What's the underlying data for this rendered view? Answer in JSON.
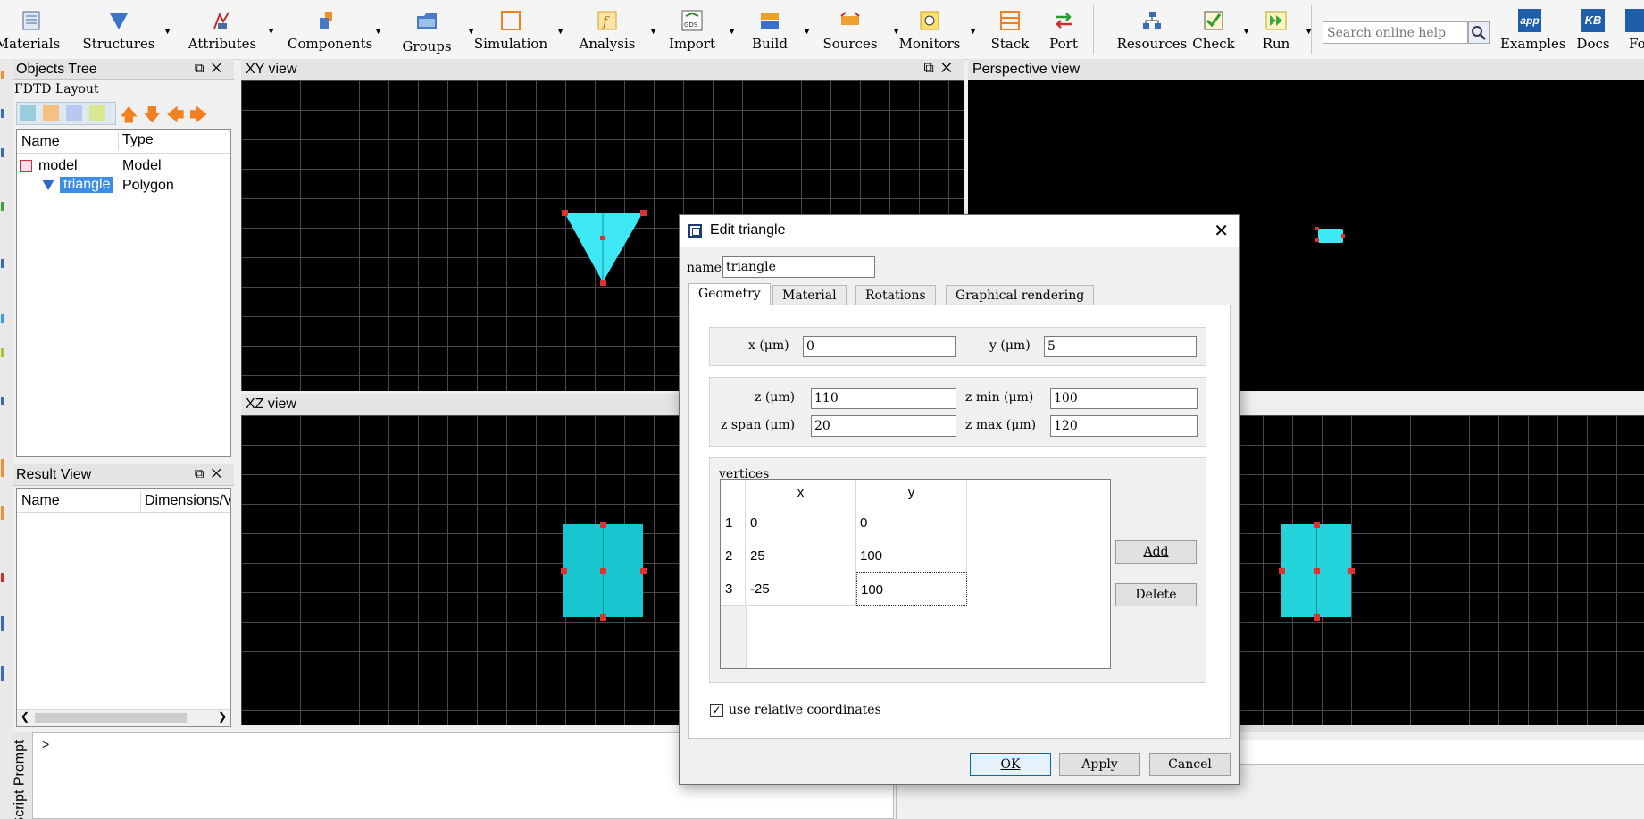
{
  "toolbar": {
    "items": [
      {
        "label": "Materials",
        "icon": "materials-icon"
      },
      {
        "label": "Structures",
        "icon": "structures-icon"
      },
      {
        "label": "Attributes",
        "icon": "attributes-icon"
      },
      {
        "label": "Components",
        "icon": "components-icon"
      },
      {
        "label": "Groups",
        "icon": "groups-icon"
      },
      {
        "label": "Simulation",
        "icon": "simulation-icon"
      },
      {
        "label": "Analysis",
        "icon": "analysis-icon"
      },
      {
        "label": "Import",
        "icon": "import-icon"
      },
      {
        "label": "Build",
        "icon": "build-icon"
      },
      {
        "label": "Sources",
        "icon": "sources-icon"
      },
      {
        "label": "Monitors",
        "icon": "monitors-icon"
      },
      {
        "label": "Stack",
        "icon": "stack-icon"
      },
      {
        "label": "Port",
        "icon": "port-icon"
      },
      {
        "label": "Resources",
        "icon": "resources-icon"
      },
      {
        "label": "Check",
        "icon": "check-icon"
      },
      {
        "label": "Run",
        "icon": "run-icon"
      },
      {
        "label": "Examples",
        "icon": "app-icon"
      },
      {
        "label": "Docs",
        "icon": "kb-icon"
      },
      {
        "label": "Fo",
        "icon": "forum-icon"
      }
    ],
    "help_search_placeholder": "Search online help",
    "icon_text": {
      "gds": "GDS",
      "app": "app",
      "kb": "KB"
    }
  },
  "objects_tree": {
    "title": "Objects Tree",
    "layout_label": "FDTD Layout",
    "col_name": "Name",
    "col_type": "Type",
    "rows": [
      {
        "name": "model",
        "type": "Model"
      },
      {
        "name": "triangle",
        "type": "Polygon"
      }
    ]
  },
  "result_view": {
    "title": "Result View",
    "col_name": "Name",
    "col_dims": "Dimensions/V"
  },
  "views": {
    "xy": "XY view",
    "xz": "XZ view",
    "perspective": "Perspective view"
  },
  "prompt": {
    "title": "Script Prompt",
    "caret": ">"
  },
  "dialog": {
    "title": "Edit triangle",
    "name_label": "name",
    "name_value": "triangle",
    "tabs": [
      "Geometry",
      "Material",
      "Rotations",
      "Graphical rendering"
    ],
    "active_tab": "Geometry",
    "x_label": "x (μm)",
    "x_value": "0",
    "y_label": "y (μm)",
    "y_value": "5",
    "z_label": "z (μm)",
    "z_value": "110",
    "zmin_label": "z min (μm)",
    "zmin_value": "100",
    "zspan_label": "z span (μm)",
    "zspan_value": "20",
    "zmax_label": "z max (μm)",
    "zmax_value": "120",
    "vertices_label": "vertices",
    "vertices_cols": [
      "x",
      "y"
    ],
    "vertices": [
      {
        "row": "1",
        "x": "0",
        "y": "0"
      },
      {
        "row": "2",
        "x": "25",
        "y": "100"
      },
      {
        "row": "3",
        "x": "-25",
        "y": "100"
      }
    ],
    "add_label": "Add",
    "delete_label": "Delete",
    "relative_label": "use relative coordinates",
    "relative_checked": true,
    "ok_label": "OK",
    "apply_label": "Apply",
    "cancel_label": "Cancel"
  },
  "colors": {
    "shape_fill": "#3ee8f4",
    "shape_fill_xz": "#17c6cf",
    "handle": "#e03030",
    "selection": "#3a8ee6",
    "accent_orange": "#f0882a"
  }
}
